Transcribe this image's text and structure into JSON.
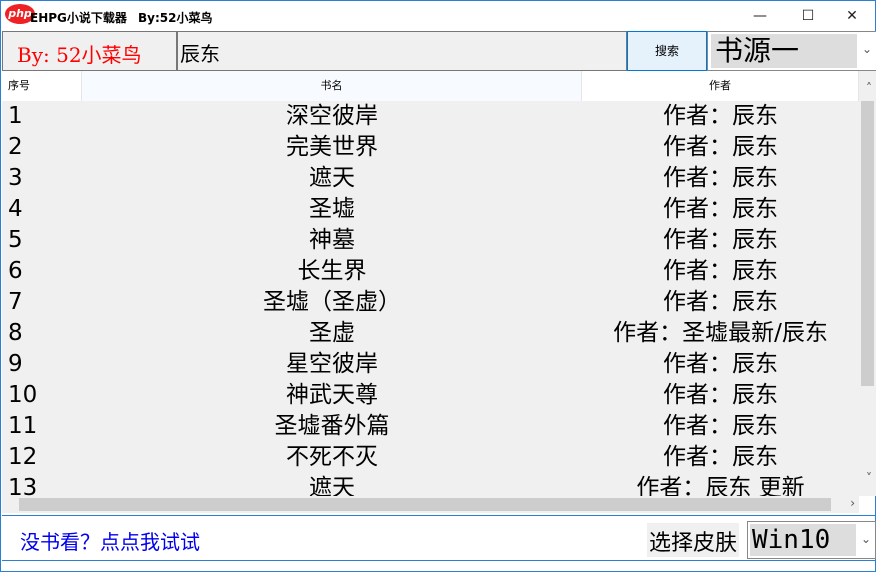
{
  "window": {
    "title": "EHPG小说下载器",
    "byline": "By:52小菜鸟",
    "watermark": "php中文网",
    "minimize": "—",
    "maximize": "☐",
    "close": "✕"
  },
  "toolbar": {
    "brand": "By: 52小菜鸟",
    "search_value": "辰东",
    "search_button": "搜索",
    "source_selected": "书源一"
  },
  "table": {
    "headers": [
      "序号",
      "书名",
      "作者"
    ],
    "rows": [
      [
        "1",
        "深空彼岸",
        "作者：辰东"
      ],
      [
        "2",
        "完美世界",
        "作者：辰东"
      ],
      [
        "3",
        "遮天",
        "作者：辰东"
      ],
      [
        "4",
        "圣墟",
        "作者：辰东"
      ],
      [
        "5",
        "神墓",
        "作者：辰东"
      ],
      [
        "6",
        "长生界",
        "作者：辰东"
      ],
      [
        "7",
        "圣墟（圣虚）",
        "作者：辰东"
      ],
      [
        "8",
        "圣虚",
        "作者：圣墟最新/辰东"
      ],
      [
        "9",
        "星空彼岸",
        "作者：辰东"
      ],
      [
        "10",
        "神武天尊",
        "作者：辰东"
      ],
      [
        "11",
        "圣墟番外篇",
        "作者：辰东"
      ],
      [
        "12",
        "不死不灭",
        "作者：辰东"
      ],
      [
        "13",
        "遮天",
        "作者：辰东 更新"
      ]
    ]
  },
  "footer": {
    "link": "没书看？点点我试试",
    "skin_label": "选择皮肤",
    "skin_selected": "Win10"
  }
}
